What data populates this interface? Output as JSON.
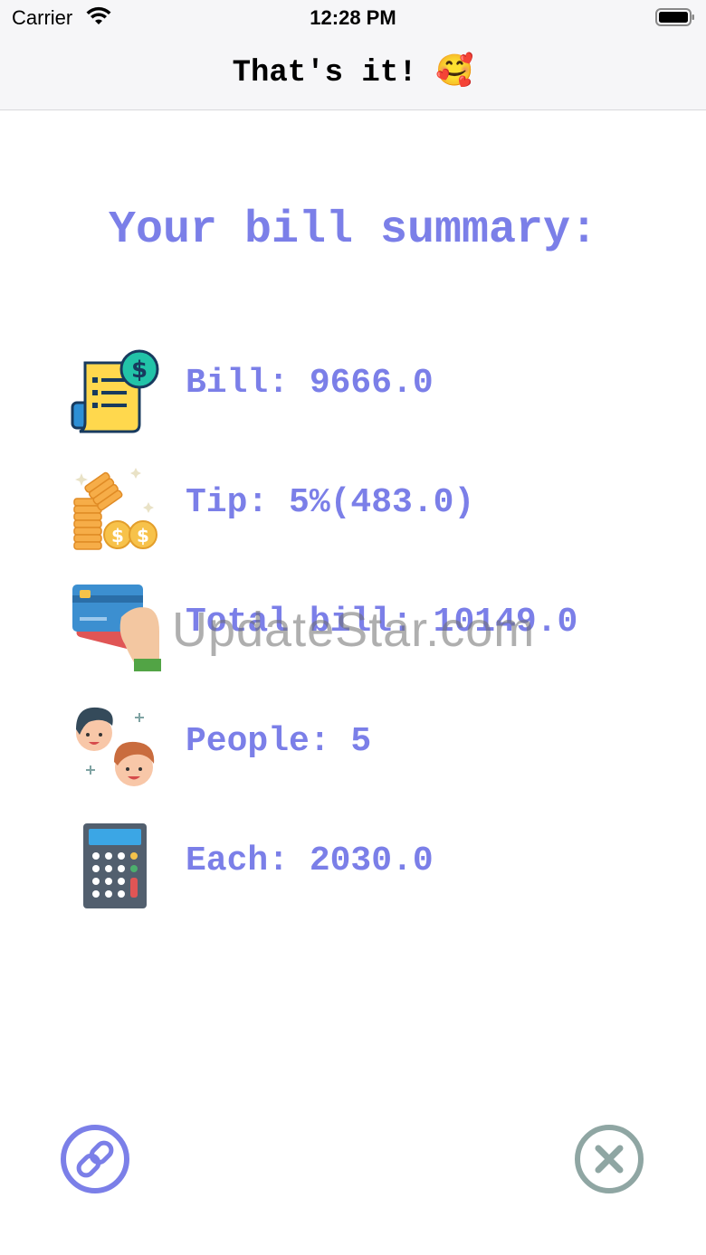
{
  "status_bar": {
    "carrier": "Carrier",
    "time": "12:28 PM"
  },
  "nav": {
    "title": "That's it!",
    "title_emoji": "🥰"
  },
  "summary": {
    "heading": "Your bill summary:",
    "rows": [
      {
        "icon": "receipt-icon",
        "text": "Bill: 9666.0"
      },
      {
        "icon": "coins-icon",
        "text": "Tip: 5%(483.0)"
      },
      {
        "icon": "credit-card-icon",
        "text": "Total bill: 10149.0"
      },
      {
        "icon": "people-icon",
        "text": "People: 5"
      },
      {
        "icon": "calculator-icon",
        "text": "Each: 2030.0"
      }
    ]
  },
  "watermark": "UpdateStar.com",
  "actions": {
    "share_icon": "link-icon",
    "close_icon": "close-icon"
  },
  "colors": {
    "accent": "#7b7fe8",
    "close": "#8fa6a3"
  }
}
